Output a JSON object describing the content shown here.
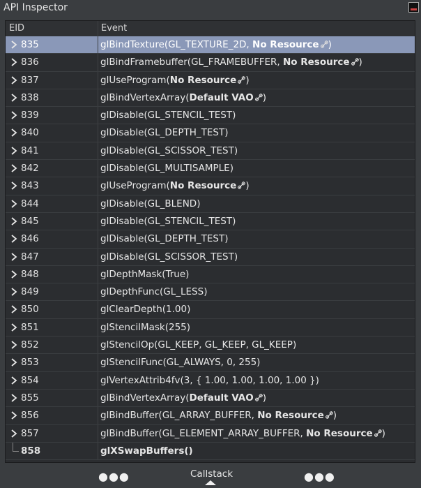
{
  "window": {
    "title": "API Inspector"
  },
  "table": {
    "columns": [
      "EID",
      "Event"
    ],
    "rows": [
      {
        "eid": "835",
        "pre": "glBindTexture(GL_TEXTURE_2D, ",
        "bold": "No Resource",
        "link": true,
        "post": ")",
        "selected": true,
        "expandable": true
      },
      {
        "eid": "836",
        "pre": "glBindFramebuffer(GL_FRAMEBUFFER, ",
        "bold": "No Resource",
        "link": true,
        "post": ")",
        "selected": false,
        "expandable": true
      },
      {
        "eid": "837",
        "pre": "glUseProgram(",
        "bold": "No Resource",
        "link": true,
        "post": ")",
        "selected": false,
        "expandable": true
      },
      {
        "eid": "838",
        "pre": "glBindVertexArray(",
        "bold": "Default VAO",
        "link": true,
        "post": ")",
        "selected": false,
        "expandable": true
      },
      {
        "eid": "839",
        "pre": "glDisable(GL_STENCIL_TEST)",
        "bold": "",
        "link": false,
        "post": "",
        "selected": false,
        "expandable": true
      },
      {
        "eid": "840",
        "pre": "glDisable(GL_DEPTH_TEST)",
        "bold": "",
        "link": false,
        "post": "",
        "selected": false,
        "expandable": true
      },
      {
        "eid": "841",
        "pre": "glDisable(GL_SCISSOR_TEST)",
        "bold": "",
        "link": false,
        "post": "",
        "selected": false,
        "expandable": true
      },
      {
        "eid": "842",
        "pre": "glDisable(GL_MULTISAMPLE)",
        "bold": "",
        "link": false,
        "post": "",
        "selected": false,
        "expandable": true
      },
      {
        "eid": "843",
        "pre": "glUseProgram(",
        "bold": "No Resource",
        "link": true,
        "post": ")",
        "selected": false,
        "expandable": true
      },
      {
        "eid": "844",
        "pre": "glDisable(GL_BLEND)",
        "bold": "",
        "link": false,
        "post": "",
        "selected": false,
        "expandable": true
      },
      {
        "eid": "845",
        "pre": "glDisable(GL_STENCIL_TEST)",
        "bold": "",
        "link": false,
        "post": "",
        "selected": false,
        "expandable": true
      },
      {
        "eid": "846",
        "pre": "glDisable(GL_DEPTH_TEST)",
        "bold": "",
        "link": false,
        "post": "",
        "selected": false,
        "expandable": true
      },
      {
        "eid": "847",
        "pre": "glDisable(GL_SCISSOR_TEST)",
        "bold": "",
        "link": false,
        "post": "",
        "selected": false,
        "expandable": true
      },
      {
        "eid": "848",
        "pre": "glDepthMask(True)",
        "bold": "",
        "link": false,
        "post": "",
        "selected": false,
        "expandable": true
      },
      {
        "eid": "849",
        "pre": "glDepthFunc(GL_LESS)",
        "bold": "",
        "link": false,
        "post": "",
        "selected": false,
        "expandable": true
      },
      {
        "eid": "850",
        "pre": "glClearDepth(1.00)",
        "bold": "",
        "link": false,
        "post": "",
        "selected": false,
        "expandable": true
      },
      {
        "eid": "851",
        "pre": "glStencilMask(255)",
        "bold": "",
        "link": false,
        "post": "",
        "selected": false,
        "expandable": true
      },
      {
        "eid": "852",
        "pre": "glStencilOp(GL_KEEP, GL_KEEP, GL_KEEP)",
        "bold": "",
        "link": false,
        "post": "",
        "selected": false,
        "expandable": true
      },
      {
        "eid": "853",
        "pre": "glStencilFunc(GL_ALWAYS, 0, 255)",
        "bold": "",
        "link": false,
        "post": "",
        "selected": false,
        "expandable": true
      },
      {
        "eid": "854",
        "pre": "glVertexAttrib4fv(3, { 1.00, 1.00, 1.00, 1.00 })",
        "bold": "",
        "link": false,
        "post": "",
        "selected": false,
        "expandable": true
      },
      {
        "eid": "855",
        "pre": "glBindVertexArray(",
        "bold": "Default VAO",
        "link": true,
        "post": ")",
        "selected": false,
        "expandable": true
      },
      {
        "eid": "856",
        "pre": "glBindBuffer(GL_ARRAY_BUFFER, ",
        "bold": "No Resource",
        "link": true,
        "post": ")",
        "selected": false,
        "expandable": true
      },
      {
        "eid": "857",
        "pre": "glBindBuffer(GL_ELEMENT_ARRAY_BUFFER, ",
        "bold": "No Resource",
        "link": true,
        "post": ")",
        "selected": false,
        "expandable": true
      },
      {
        "eid": "858",
        "pre": "",
        "bold": "glXSwapBuffers()",
        "link": false,
        "post": "",
        "selected": false,
        "expandable": false
      }
    ]
  },
  "bottombar": {
    "left_dots": "●●●",
    "callstack_label": "Callstack",
    "right_dots": "●●●"
  },
  "colors": {
    "selection": "#8a98b8",
    "panel": "#2b2d30",
    "window": "#3a3d40"
  },
  "icons": {
    "row_chevron": "chevron-right-icon",
    "resource_link": "link-icon",
    "window_button": "window-restore-icon",
    "callstack_toggle": "caret-up-icon"
  }
}
